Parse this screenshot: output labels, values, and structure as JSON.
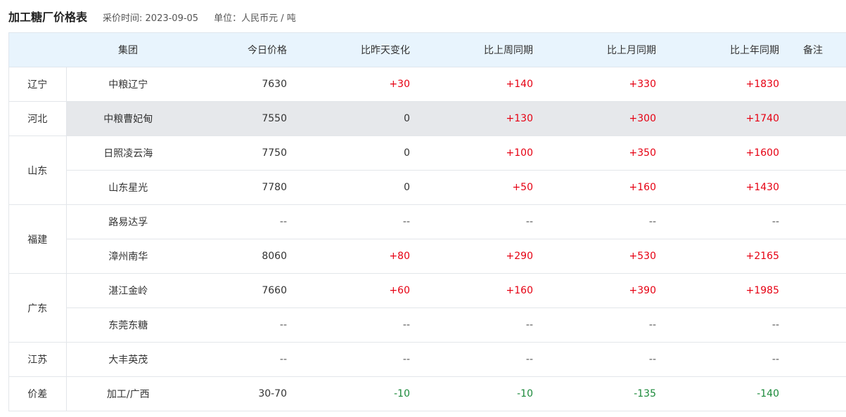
{
  "header": {
    "title": "加工糖厂价格表",
    "price_time": "采价时间: 2023-09-05",
    "unit": "单位：人民币元 / 吨"
  },
  "columns": [
    "集团",
    "今日价格",
    "比昨天变化",
    "比上周同期",
    "比上月同期",
    "比上年同期",
    "备注"
  ],
  "rows": [
    {
      "province": "辽宁",
      "group": "中粮辽宁",
      "price": "7630",
      "day": "+30",
      "week": "+140",
      "month": "+330",
      "year": "+1830"
    },
    {
      "province": "河北",
      "group": "中粮曹妃甸",
      "price": "7550",
      "day": "0",
      "week": "+130",
      "month": "+300",
      "year": "+1740",
      "highlight": true
    },
    {
      "province": "山东",
      "group": "日照凌云海",
      "price": "7750",
      "day": "0",
      "week": "+100",
      "month": "+350",
      "year": "+1600"
    },
    {
      "province": "",
      "group": "山东星光",
      "price": "7780",
      "day": "0",
      "week": "+50",
      "month": "+160",
      "year": "+1430"
    },
    {
      "province": "福建",
      "group": "路易达孚",
      "price": "--",
      "day": "--",
      "week": "--",
      "month": "--",
      "year": "--"
    },
    {
      "province": "",
      "group": "漳州南华",
      "price": "8060",
      "day": "+80",
      "week": "+290",
      "month": "+530",
      "year": "+2165"
    },
    {
      "province": "广东",
      "group": "湛江金岭",
      "price": "7660",
      "day": "+60",
      "week": "+160",
      "month": "+390",
      "year": "+1985"
    },
    {
      "province": "",
      "group": "东莞东糖",
      "price": "--",
      "day": "--",
      "week": "--",
      "month": "--",
      "year": "--"
    },
    {
      "province": "江苏",
      "group": "大丰英茂",
      "price": "--",
      "day": "--",
      "week": "--",
      "month": "--",
      "year": "--"
    },
    {
      "province": "价差",
      "group": "加工/广西",
      "price": "30-70",
      "day": "-10",
      "week": "-10",
      "month": "-135",
      "year": "-140"
    }
  ],
  "colors": {
    "up": "#e60012",
    "down": "#1b8a3a",
    "header_bg": "#e8f4fd",
    "highlight_bg": "#e6e8eb"
  }
}
